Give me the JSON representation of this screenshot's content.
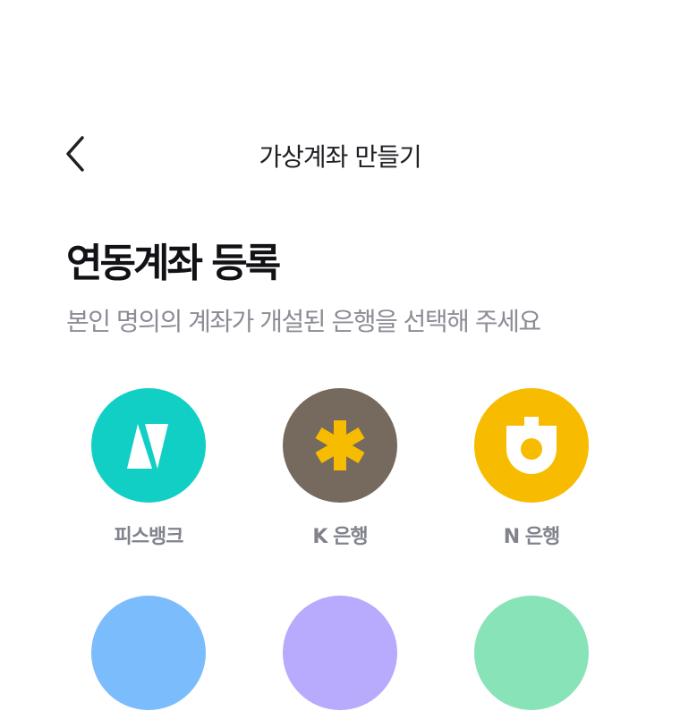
{
  "header": {
    "back_icon": "chevron-left-icon",
    "title": "가상계좌 만들기"
  },
  "main": {
    "title": "연동계좌 등록",
    "subtitle": "본인 명의의 계좌가 개설된 은행을 선택해 주세요"
  },
  "banks": [
    {
      "name": "피스뱅크",
      "color": "#12cfc6",
      "icon": "pisbank-logo-icon"
    },
    {
      "name": "K 은행",
      "color": "#766a5e",
      "icon": "asterisk-logo-icon"
    },
    {
      "name": "N 은행",
      "color": "#f7bb00",
      "icon": "n-bank-logo-icon"
    },
    {
      "name": "",
      "color": "#7bbcfc",
      "icon": "blank-circle-icon"
    },
    {
      "name": "",
      "color": "#b8aafd",
      "icon": "blank-circle-icon"
    },
    {
      "name": "",
      "color": "#88e3b8",
      "icon": "blank-circle-icon"
    }
  ],
  "colors": {
    "text_primary": "#111116",
    "text_secondary": "#8b8d96",
    "bank_label": "#80838c",
    "asterisk_yellow": "#f7bb00"
  }
}
